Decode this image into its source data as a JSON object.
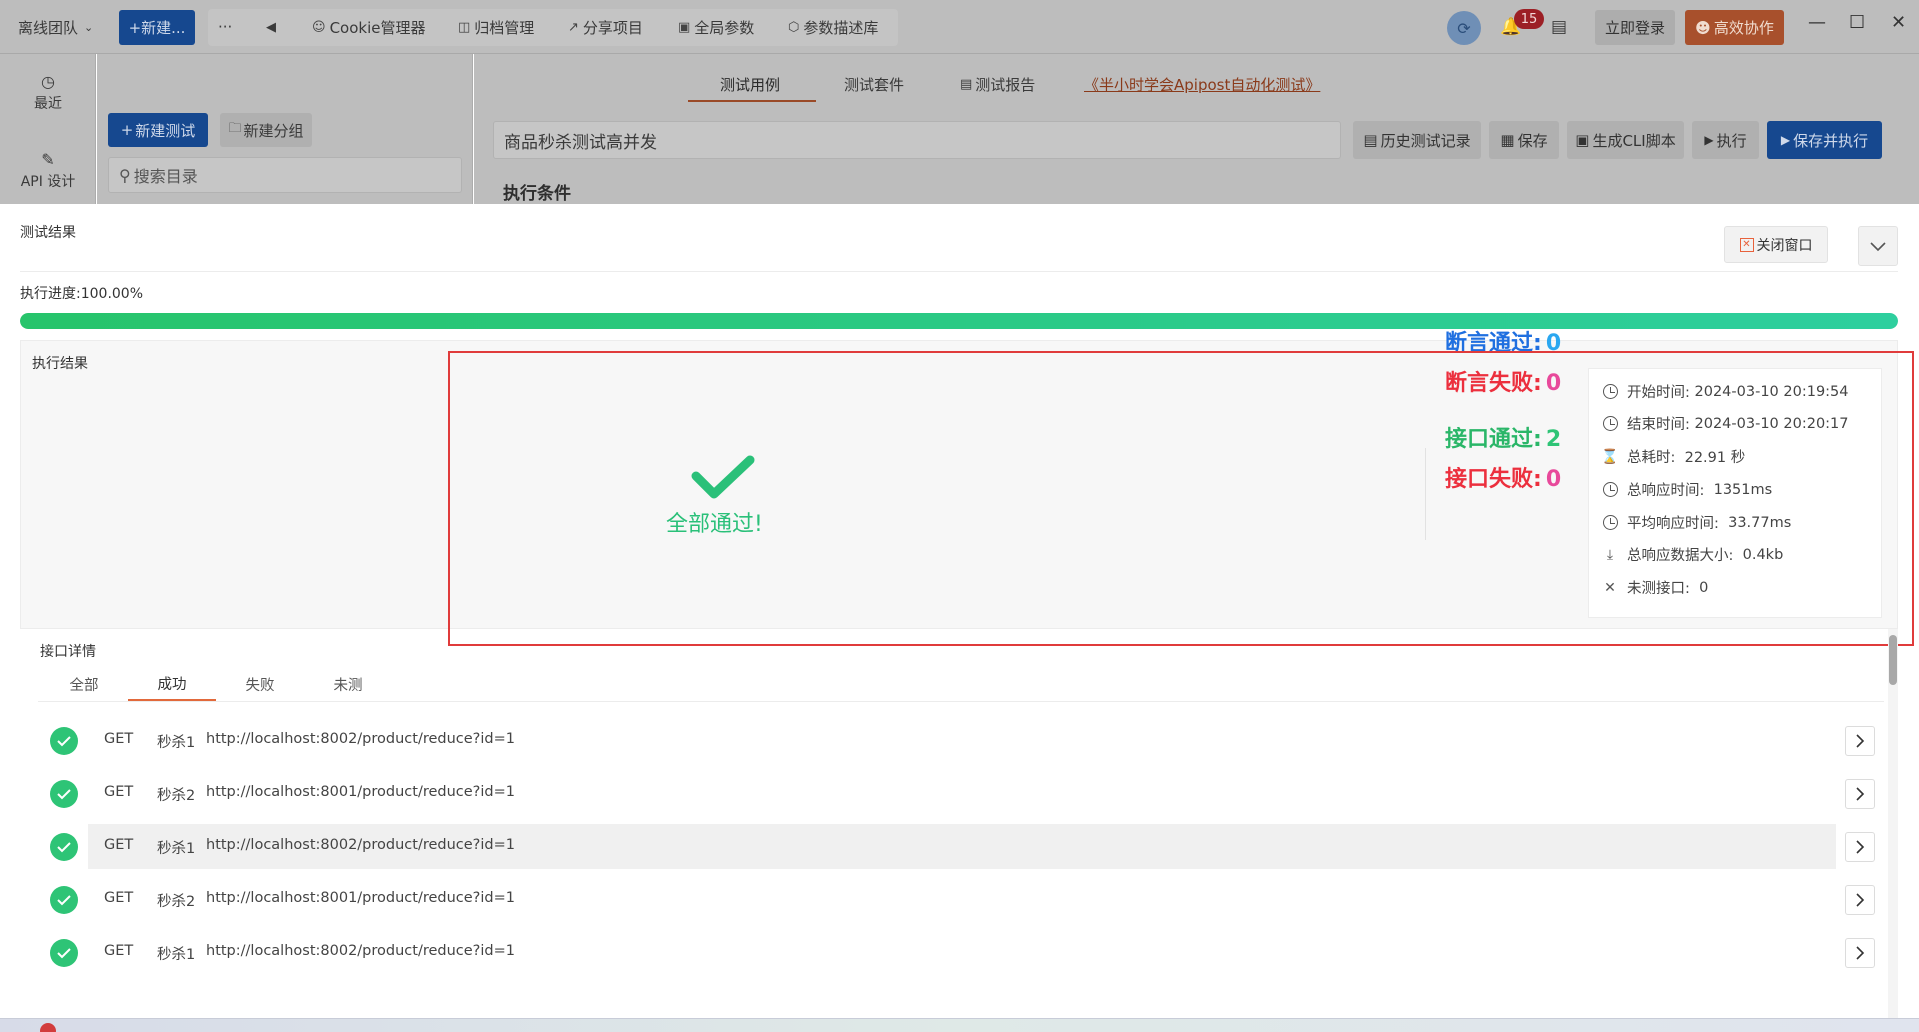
{
  "topbar": {
    "team": "离线团队",
    "new_button": "+新建...",
    "more": "···",
    "back": "◀",
    "menu": [
      {
        "label": "Cookie管理器",
        "icon": "cookie-icon"
      },
      {
        "label": "归档管理",
        "icon": "archive-icon"
      },
      {
        "label": "分享项目",
        "icon": "share-icon"
      },
      {
        "label": "全局参数",
        "icon": "params-icon"
      },
      {
        "label": "参数描述库",
        "icon": "box-icon"
      }
    ],
    "notifications": "15",
    "login": "立即登录",
    "collab": "高效协作"
  },
  "sidebar": {
    "items": [
      {
        "label": "最近",
        "icon": "history-icon"
      },
      {
        "label": "API 设计",
        "icon": "edit-icon"
      }
    ]
  },
  "leftpanel": {
    "new_test": "新建测试",
    "new_group": "新建分组",
    "search_placeholder": "搜索目录"
  },
  "main": {
    "tabs": [
      {
        "label": "测试用例",
        "active": true
      },
      {
        "label": "测试套件"
      },
      {
        "label": "测试报告"
      },
      {
        "label": "《半小时学会Apipost自动化测试》",
        "link": true
      }
    ],
    "test_name": "商品秒杀测试高并发",
    "buttons": {
      "history": "历史测试记录",
      "save": "保存",
      "cli": "生成CLI脚本",
      "run": "执行",
      "save_run": "保存并执行"
    },
    "section_title": "执行条件"
  },
  "result": {
    "title": "测试结果",
    "close": "关闭窗口",
    "progress_label": "执行进度:100.00%",
    "progress": 1.0,
    "exec_title": "执行结果",
    "all_pass": "全部通过!",
    "stats": [
      {
        "label": "断言通过:",
        "value": "0",
        "label_color": "#1f6fe0",
        "value_color": "#2aa7f0"
      },
      {
        "label": "断言失败:",
        "value": "0",
        "label_color": "#ec2f3d",
        "value_color": "#e8499b"
      },
      {
        "label": "接口通过:",
        "value": "2",
        "label_color": "#2ab668",
        "value_color": "#2ec476"
      },
      {
        "label": "接口失败:",
        "value": "0",
        "label_color": "#ec2f3d",
        "value_color": "#e8499b"
      }
    ],
    "info": [
      {
        "label": "开始时间:",
        "value": "2024-03-10 20:19:54",
        "icon": "clock-icon"
      },
      {
        "label": "结束时间:",
        "value": "2024-03-10 20:20:17",
        "icon": "clock-icon"
      },
      {
        "label": "总耗时:",
        "value": "22.91 秒",
        "icon": "hourglass-icon"
      },
      {
        "label": "总响应时间:",
        "value": "1351ms",
        "icon": "clock-icon"
      },
      {
        "label": "平均响应时间:",
        "value": "33.77ms",
        "icon": "clock-icon"
      },
      {
        "label": "总响应数据大小:",
        "value": "0.4kb",
        "icon": "download-icon"
      },
      {
        "label": "未测接口:",
        "value": "0",
        "icon": "cross-icon"
      }
    ],
    "details_title": "接口详情",
    "detail_tabs": [
      {
        "label": "全部"
      },
      {
        "label": "成功",
        "active": true
      },
      {
        "label": "失败"
      },
      {
        "label": "未测"
      }
    ],
    "rows": [
      {
        "method": "GET",
        "name": "秒杀1",
        "url": "http://localhost:8002/product/reduce?id=1"
      },
      {
        "method": "GET",
        "name": "秒杀2",
        "url": "http://localhost:8001/product/reduce?id=1"
      },
      {
        "method": "GET",
        "name": "秒杀1",
        "url": "http://localhost:8002/product/reduce?id=1",
        "highlight": true
      },
      {
        "method": "GET",
        "name": "秒杀2",
        "url": "http://localhost:8001/product/reduce?id=1"
      },
      {
        "method": "GET",
        "name": "秒杀1",
        "url": "http://localhost:8002/product/reduce?id=1"
      }
    ]
  }
}
